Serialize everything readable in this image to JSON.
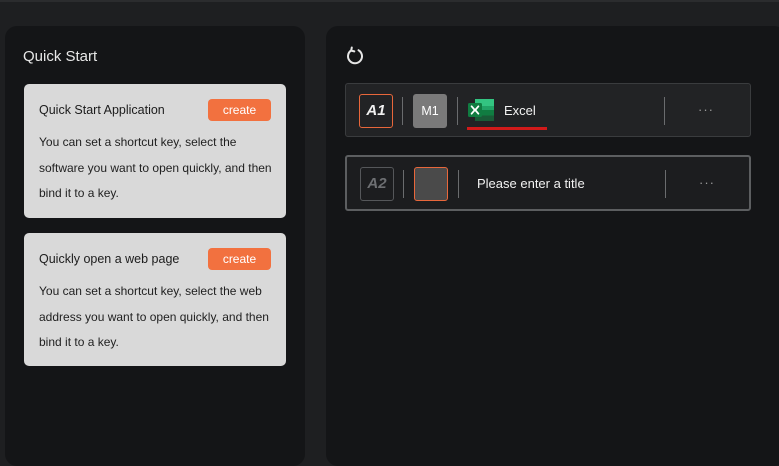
{
  "left_panel": {
    "title": "Quick Start",
    "cards": [
      {
        "title": "Quick Start Application",
        "button": "create",
        "description": "You can set a shortcut key, select the software you want to open quickly, and then bind it to a key."
      },
      {
        "title": "Quickly open a web page",
        "button": "create",
        "description": "You can set a shortcut key, select the web address you want to open quickly, and then bind it to a key."
      }
    ]
  },
  "right_panel": {
    "refresh_icon": "refresh-icon",
    "rows": [
      {
        "key": "A1",
        "modifier": "M1",
        "app_icon": "excel-icon",
        "app_name": "Excel",
        "more": "···"
      },
      {
        "key": "A2",
        "modifier": "",
        "title_placeholder": "Please enter a title",
        "more": "···"
      }
    ]
  },
  "colors": {
    "accent": "#f2713f",
    "underline": "#d11a1a",
    "panel": "#141517",
    "card": "#d9d9d9"
  }
}
